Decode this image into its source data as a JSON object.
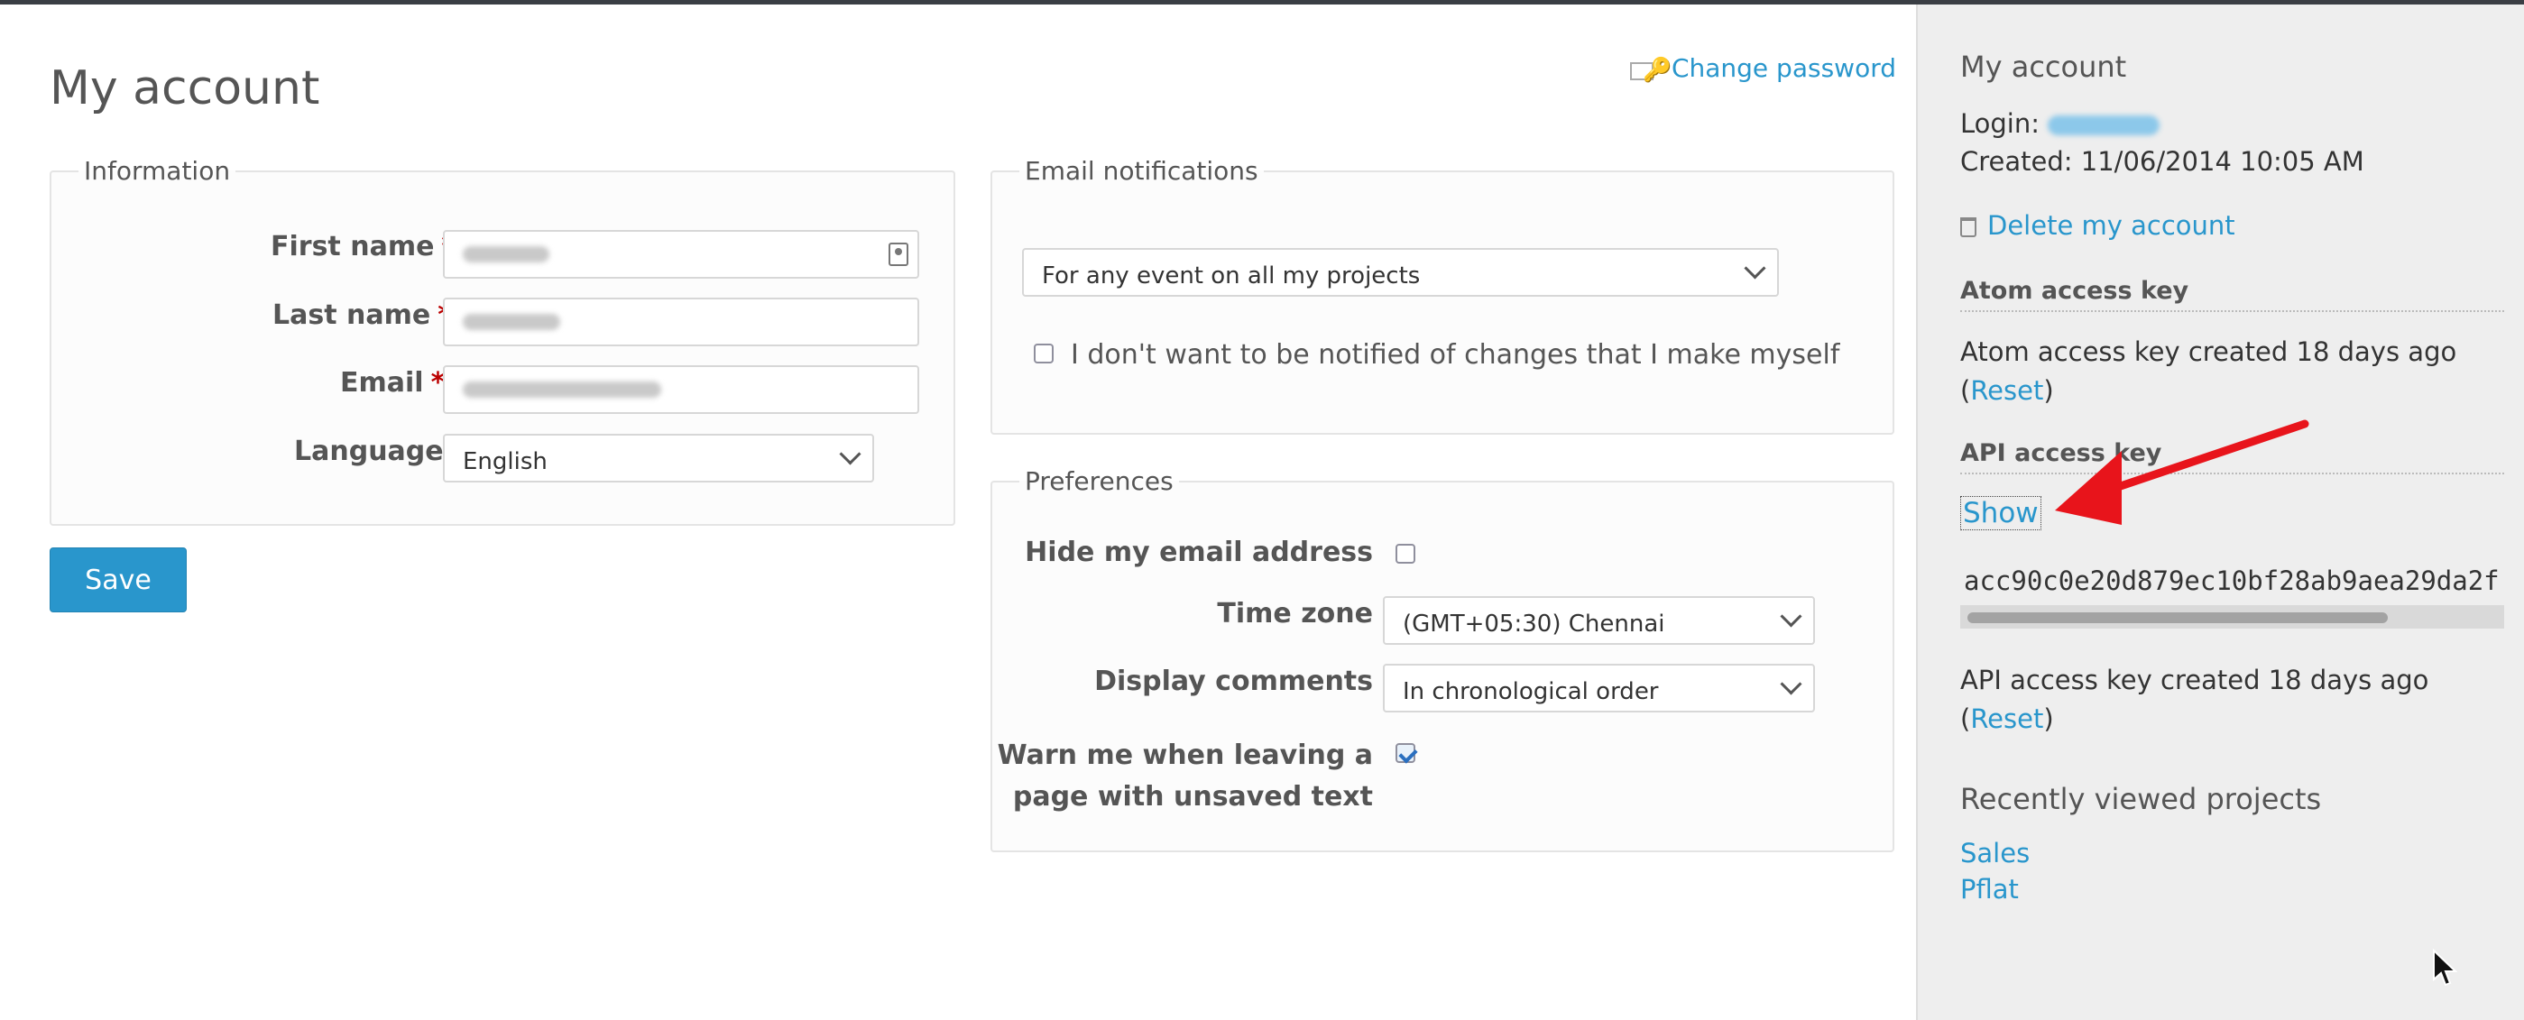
{
  "main": {
    "title": "My account",
    "change_password": "Change password",
    "information": {
      "legend": "Information",
      "first_name_label": "First name",
      "last_name_label": "Last name",
      "email_label": "Email",
      "language_label": "Language",
      "required_mark": "*",
      "language_value": "English"
    },
    "email_notifications": {
      "legend": "Email notifications",
      "selected": "For any event on all my projects",
      "no_self_notified_label": "I don't want to be notified of changes that I make myself"
    },
    "preferences": {
      "legend": "Preferences",
      "hide_email_label": "Hide my email address",
      "time_zone_label": "Time zone",
      "time_zone_value": "(GMT+05:30) Chennai",
      "display_comments_label": "Display comments",
      "display_comments_value": "In chronological order",
      "warn_leaving_line1": "Warn me when leaving a",
      "warn_leaving_line2": "page with unsaved text"
    },
    "save_label": "Save"
  },
  "sidebar": {
    "my_account_heading": "My account",
    "login_label": "Login:",
    "created_label": "Created:",
    "created_value": "11/06/2014 10:05 AM",
    "delete_account": "Delete my account",
    "atom": {
      "heading": "Atom access key",
      "created_text": "Atom access key created 18 days ago",
      "reset": "Reset"
    },
    "api": {
      "heading": "API access key",
      "show": "Show",
      "key_value": "acc90c0e20d879ec10bf28ab9aea29da2f",
      "created_text": "API access key created 18 days ago",
      "reset": "Reset"
    },
    "recent": {
      "heading": "Recently viewed projects",
      "projects": [
        "Sales",
        "Pflat"
      ]
    }
  },
  "colors": {
    "link": "#2996cc",
    "required": "#bb0000",
    "annotation_arrow": "#e8141b",
    "save_button": "#2996cc"
  },
  "icons": [
    "key-icon",
    "contact-card-icon",
    "chevron-down-icon",
    "trash-icon",
    "red-arrow-annotation",
    "mouse-cursor-icon"
  ]
}
